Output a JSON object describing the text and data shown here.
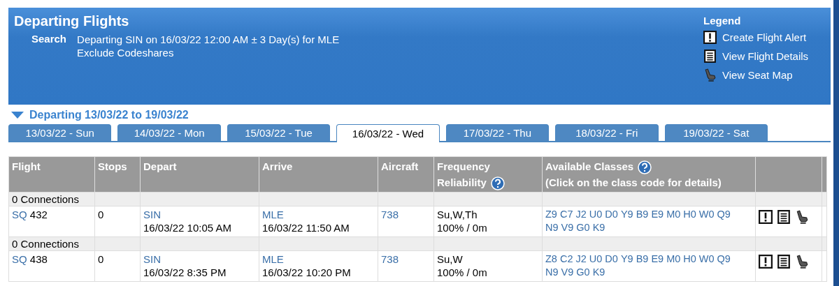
{
  "banner": {
    "title": "Departing Flights",
    "search_label": "Search",
    "search_lines": [
      "Departing SIN on 16/03/22 12:00 AM ± 3 Day(s) for MLE",
      "Exclude Codeshares"
    ],
    "legend": {
      "title": "Legend",
      "items": [
        {
          "kind": "alert",
          "label": "Create Flight Alert"
        },
        {
          "kind": "details",
          "label": "View Flight Details"
        },
        {
          "kind": "seat",
          "label": "View Seat Map"
        }
      ]
    }
  },
  "range": {
    "label": "Departing 13/03/22 to 19/03/22",
    "expanded": true
  },
  "tabs": [
    {
      "label": "13/03/22 - Sun",
      "selected": false
    },
    {
      "label": "14/03/22 - Mon",
      "selected": false
    },
    {
      "label": "15/03/22 - Tue",
      "selected": false
    },
    {
      "label": "16/03/22 - Wed",
      "selected": true
    },
    {
      "label": "17/03/22 - Thu",
      "selected": false
    },
    {
      "label": "18/03/22 - Fri",
      "selected": false
    },
    {
      "label": "19/03/22 - Sat",
      "selected": false
    }
  ],
  "table": {
    "columns": [
      {
        "label": "Flight"
      },
      {
        "label": "Stops"
      },
      {
        "label": "Depart"
      },
      {
        "label": "Arrive"
      },
      {
        "label": "Aircraft"
      },
      {
        "label": "Frequency",
        "label2": "Reliability",
        "help": true
      },
      {
        "label": "Available Classes",
        "label2": "(Click on the class code for details)",
        "help": true
      }
    ],
    "groups": [
      {
        "connections": "0 Connections",
        "flights": [
          {
            "carrier": "SQ",
            "number": "432",
            "stops": "0",
            "dep_airport": "SIN",
            "dep_time": "16/03/22 10:05 AM",
            "arr_airport": "MLE",
            "arr_time": "16/03/22 11:50 AM",
            "aircraft": "738",
            "frequency": "Su,W,Th",
            "reliability": "100% / 0m",
            "classes": [
              "Z9",
              "C7",
              "J2",
              "U0",
              "D0",
              "Y9",
              "B9",
              "E9",
              "M0",
              "H0",
              "W0",
              "Q9",
              "N9",
              "V9",
              "G0",
              "K9"
            ]
          }
        ]
      },
      {
        "connections": "0 Connections",
        "flights": [
          {
            "carrier": "SQ",
            "number": "438",
            "stops": "0",
            "dep_airport": "SIN",
            "dep_time": "16/03/22 8:35 PM",
            "arr_airport": "MLE",
            "arr_time": "16/03/22 10:20 PM",
            "aircraft": "738",
            "frequency": "Su,W",
            "reliability": "100% / 0m",
            "classes": [
              "Z8",
              "C2",
              "J2",
              "U0",
              "D0",
              "Y9",
              "B9",
              "E9",
              "M0",
              "H0",
              "W0",
              "Q9",
              "N9",
              "V9",
              "G0",
              "K9"
            ]
          }
        ]
      }
    ]
  }
}
